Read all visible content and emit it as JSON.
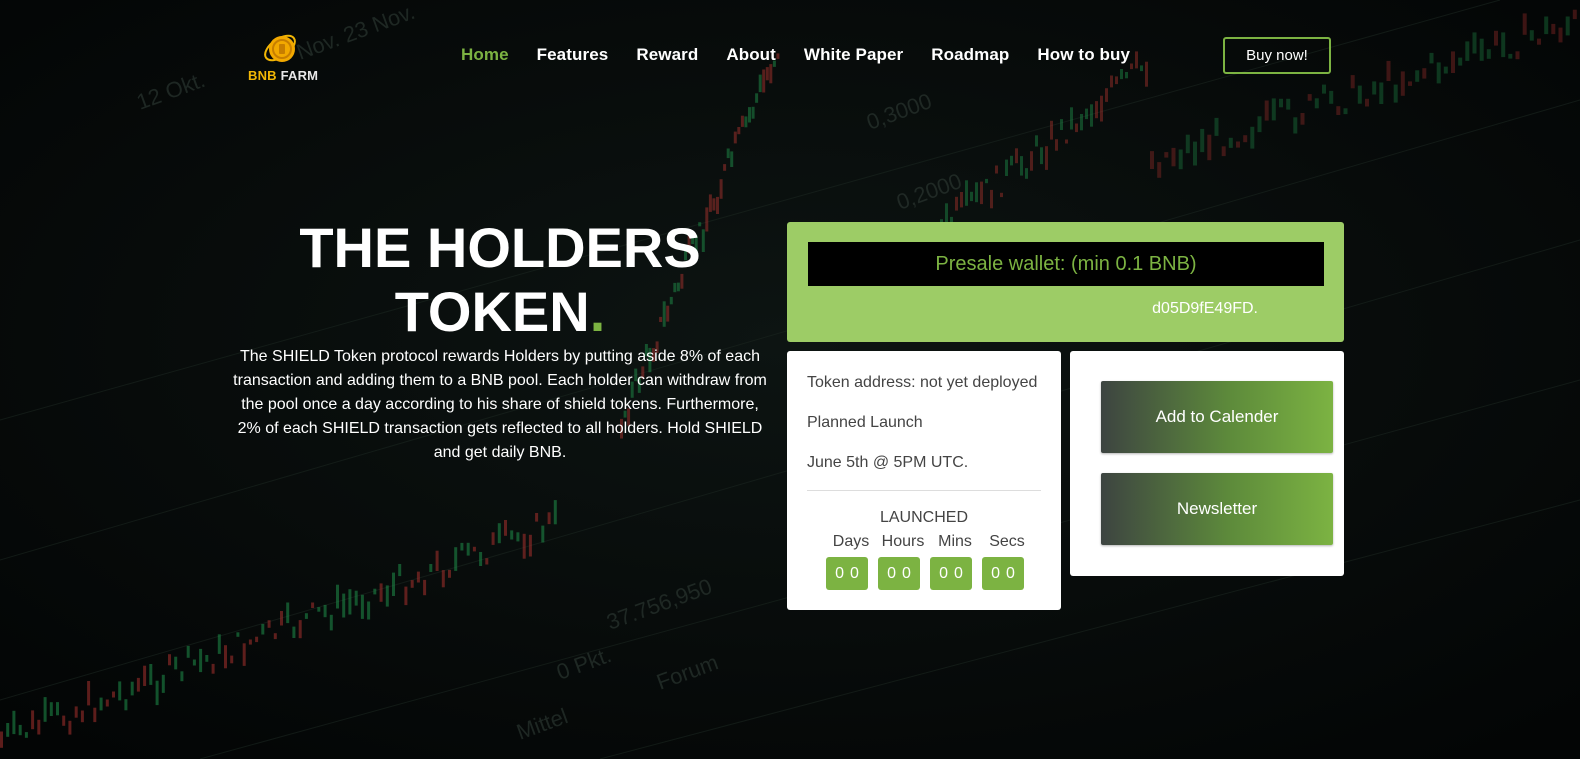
{
  "brand": {
    "name_first": "BNB",
    "name_second": "FARM"
  },
  "nav": {
    "items": [
      {
        "label": "Home",
        "active": true
      },
      {
        "label": "Features"
      },
      {
        "label": "Reward"
      },
      {
        "label": "About"
      },
      {
        "label": "White Paper"
      },
      {
        "label": "Roadmap"
      },
      {
        "label": "How to buy"
      }
    ]
  },
  "header": {
    "buy_label": "Buy now!"
  },
  "hero": {
    "title_line1": "THE HOLDERS",
    "title_line2": "TOKEN",
    "title_dot": ".",
    "description": "The SHIELD Token protocol rewards Holders by putting aside 8% of each transaction and adding them to a BNB pool. Each holder can withdraw from the pool once a day according to his share of shield tokens. Furthermore, 2% of each SHIELD transaction gets reflected to all holders. Hold SHIELD and get daily BNB."
  },
  "presale": {
    "wallet_label": "Presale wallet: (min 0.1 BNB)",
    "wallet_address": "d05D9fE49FD."
  },
  "info": {
    "token_address": "Token address: not yet deployed",
    "planned_launch": "Planned Launch",
    "launch_date": "June 5th @ 5PM UTC.",
    "status": "LAUNCHED",
    "countdown": {
      "labels": [
        "Days",
        "Hours",
        "Mins",
        "Secs"
      ],
      "values": [
        "00",
        "00",
        "00",
        "00"
      ]
    }
  },
  "actions": {
    "calendar_label": "Add to Calender",
    "newsletter_label": "Newsletter"
  },
  "colors": {
    "accent": "#7cb342",
    "panel_green": "#9dcc66",
    "background": "#05080a"
  }
}
